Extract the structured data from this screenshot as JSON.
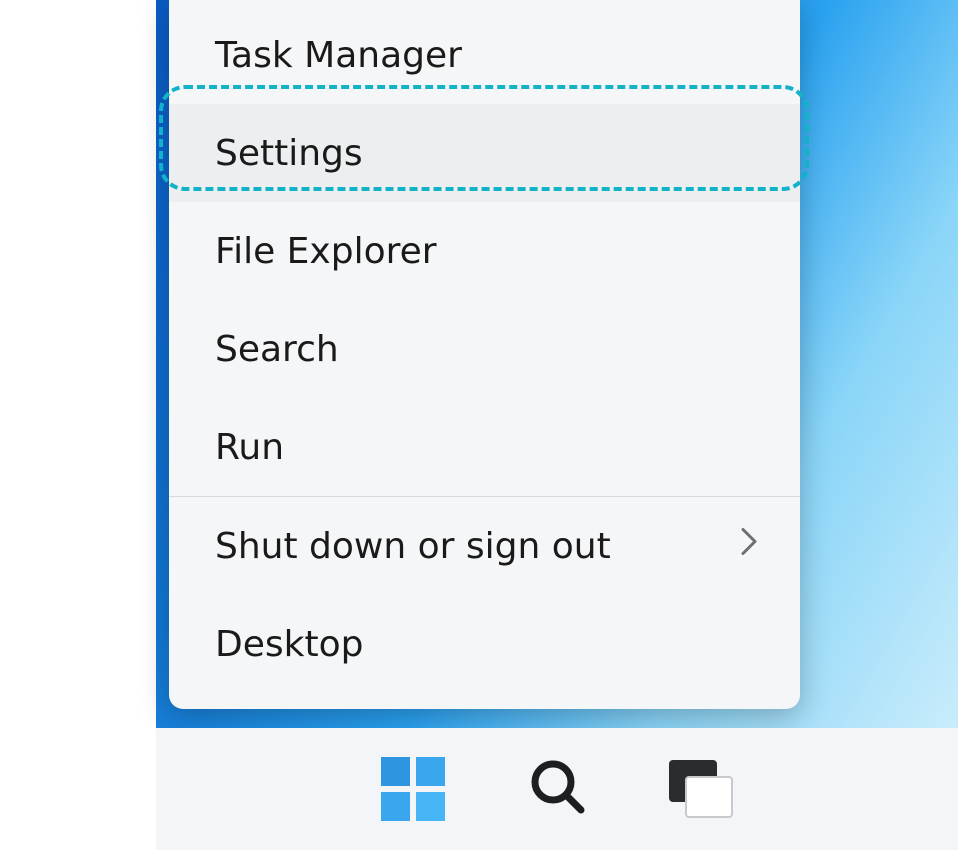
{
  "menu": {
    "items": [
      {
        "label": "Task Manager",
        "has_submenu": false,
        "hovered": false
      },
      {
        "label": "Settings",
        "has_submenu": false,
        "hovered": true
      },
      {
        "label": "File Explorer",
        "has_submenu": false,
        "hovered": false
      },
      {
        "label": "Search",
        "has_submenu": false,
        "hovered": false
      },
      {
        "label": "Run",
        "has_submenu": false,
        "hovered": false
      },
      {
        "label": "Shut down or sign out",
        "has_submenu": true,
        "hovered": false
      },
      {
        "label": "Desktop",
        "has_submenu": false,
        "hovered": false
      }
    ],
    "divider_after_index": 4
  },
  "taskbar": {
    "buttons": [
      {
        "name": "start",
        "icon": "windows-start-icon"
      },
      {
        "name": "search",
        "icon": "search-icon"
      },
      {
        "name": "task-view",
        "icon": "task-view-icon"
      }
    ]
  }
}
